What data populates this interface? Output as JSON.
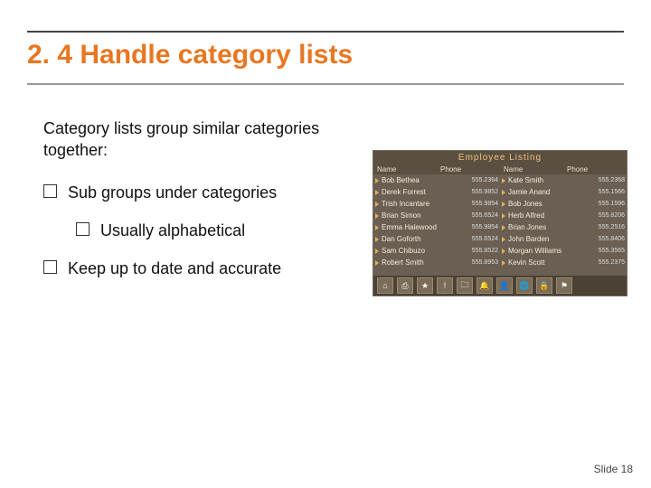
{
  "title": "2. 4 Handle category lists",
  "intro": "Category lists group similar categories together:",
  "bullets": {
    "b1": "Sub groups under categories",
    "b1a": "Usually alphabetical",
    "b2": "Keep up to date and accurate"
  },
  "figure": {
    "title": "Employee Listing",
    "headers": {
      "name": "Name",
      "phone": "Phone",
      "name2": "Name",
      "phone2": "Phone"
    },
    "left": [
      {
        "name": "Bob Bethea",
        "phone": "555.2364"
      },
      {
        "name": "Derek Forrest",
        "phone": "555.9852"
      },
      {
        "name": "Trish Incantare",
        "phone": "555.9854"
      },
      {
        "name": "Brian Simon",
        "phone": "555.6524"
      },
      {
        "name": "Emma Halewood",
        "phone": "555.9854"
      },
      {
        "name": "Dan Goforth",
        "phone": "555.6524"
      },
      {
        "name": "Sam Chibuzo",
        "phone": "555.8522"
      },
      {
        "name": "Robert Smith",
        "phone": "555.8953"
      }
    ],
    "right": [
      {
        "name": "Kate Smith",
        "phone": "555.2368"
      },
      {
        "name": "Jamie Anand",
        "phone": "555.1566"
      },
      {
        "name": "Bob Jones",
        "phone": "555.1596"
      },
      {
        "name": "Herb Alfred",
        "phone": "555.8206"
      },
      {
        "name": "Brian Jones",
        "phone": "555.2516"
      },
      {
        "name": "John Barden",
        "phone": "555.8406"
      },
      {
        "name": "Morgan Williams",
        "phone": "555.3565"
      },
      {
        "name": "Kevin Scott",
        "phone": "555.2375"
      }
    ],
    "toolbar_icons": [
      "home",
      "print",
      "bookmark",
      "warn",
      "folder",
      "bell",
      "user",
      "globe",
      "lock",
      "flag"
    ]
  },
  "footer": "Slide 18"
}
